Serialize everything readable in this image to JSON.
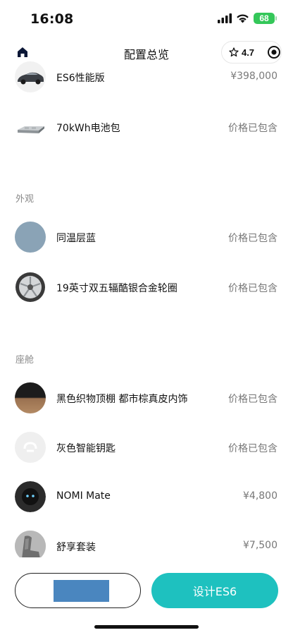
{
  "status_bar": {
    "time": "16:08",
    "battery": "68"
  },
  "nav": {
    "title": "配置总览",
    "rating": "4.7"
  },
  "top_items": [
    {
      "name": "ES6性能版",
      "price": "¥398,000",
      "thumb": "car-thumbnail"
    },
    {
      "name": "70kWh电池包",
      "price": "价格已包含",
      "thumb": "battery-pack-thumbnail"
    }
  ],
  "sections": [
    {
      "title": "外观",
      "items": [
        {
          "name": "同温层蓝",
          "price": "价格已包含",
          "thumb": "color-swatch-blue"
        },
        {
          "name": "19英寸双五辐酷银合金轮圈",
          "price": "价格已包含",
          "thumb": "wheel-thumbnail"
        }
      ]
    },
    {
      "title": "座舱",
      "items": [
        {
          "name": "黑色织物顶棚 都市棕真皮内饰",
          "price": "价格已包含",
          "thumb": "interior-swatch"
        },
        {
          "name": "灰色智能钥匙",
          "price": "价格已包含",
          "thumb": "smart-key-thumbnail"
        },
        {
          "name": "NOMI Mate",
          "price": "¥4,800",
          "thumb": "nomi-thumbnail"
        },
        {
          "name": "舒享套装",
          "price": "¥7,500",
          "thumb": "seat-thumbnail"
        }
      ]
    }
  ],
  "bottom": {
    "primary_label": "设计ES6"
  },
  "colors": {
    "accent": "#1ec1bf",
    "redaction": "#4a86bf",
    "swatch_blue": "#8aa3b6"
  }
}
